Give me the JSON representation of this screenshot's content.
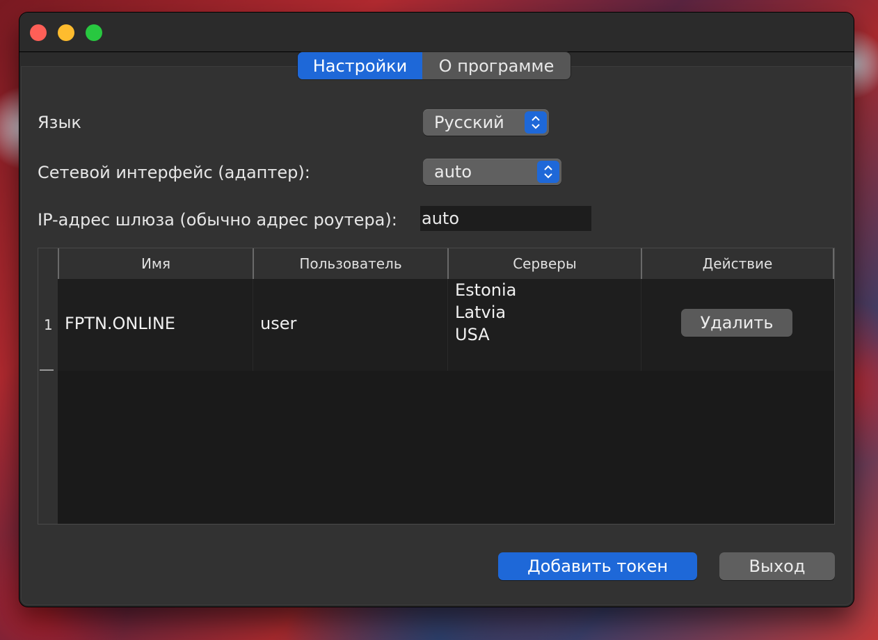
{
  "window": {
    "tabs": [
      {
        "label": "Настройки",
        "active": true
      },
      {
        "label": "О программе",
        "active": false
      }
    ]
  },
  "settings": {
    "language": {
      "label": "Язык",
      "value": "Русский"
    },
    "adapter": {
      "label": "Сетевой интерфейс (адаптер):",
      "value": "auto"
    },
    "gateway": {
      "label": "IP-адрес шлюза (обычно адрес роутера):",
      "value": "auto"
    }
  },
  "table": {
    "columns": [
      "Имя",
      "Пользователь",
      "Серверы",
      "Действие"
    ],
    "rows": [
      {
        "index": "1",
        "name": "FPTN.ONLINE",
        "user": "user",
        "servers": [
          "Estonia",
          "Latvia",
          "USA"
        ],
        "action_label": "Удалить"
      }
    ]
  },
  "footer": {
    "add_token_label": "Добавить токен",
    "exit_label": "Выход"
  },
  "colors": {
    "accent": "#1e68d8",
    "close": "#fe5f57",
    "minimize": "#febc2e",
    "maximize": "#28c840"
  },
  "icons": [
    "close-icon",
    "minimize-icon",
    "maximize-icon",
    "updown-chevron-icon"
  ]
}
